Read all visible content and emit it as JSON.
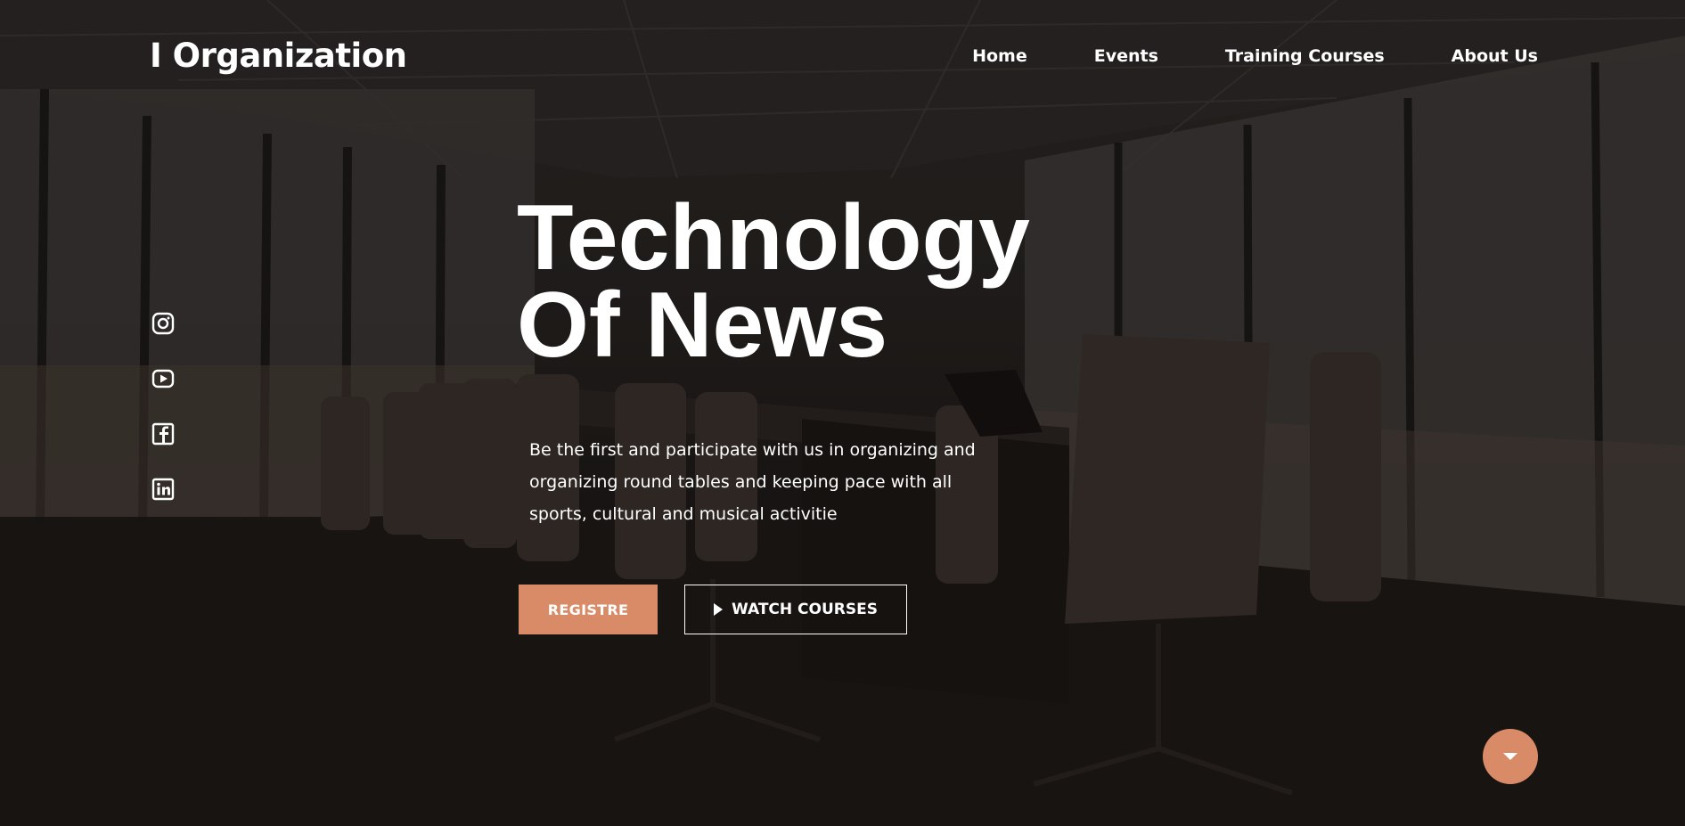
{
  "brand": {
    "logo_text": "I Organization",
    "accent_color": "#d98b68"
  },
  "nav": {
    "items": [
      {
        "label": "Home"
      },
      {
        "label": "Events"
      },
      {
        "label": "Training Courses"
      },
      {
        "label": "About Us"
      }
    ]
  },
  "social": {
    "icons": [
      "instagram-icon",
      "youtube-icon",
      "facebook-icon",
      "linkedin-icon"
    ]
  },
  "hero": {
    "headline_line1": "Technology",
    "headline_line2": "Of News",
    "description": "Be the first and participate with us in organizing and organizing round tables and keeping pace with all sports, cultural and musical activitie",
    "primary_button": "REGISTRE",
    "secondary_button": "WATCH COURSES",
    "scroll_icon": "caret-down-icon"
  }
}
